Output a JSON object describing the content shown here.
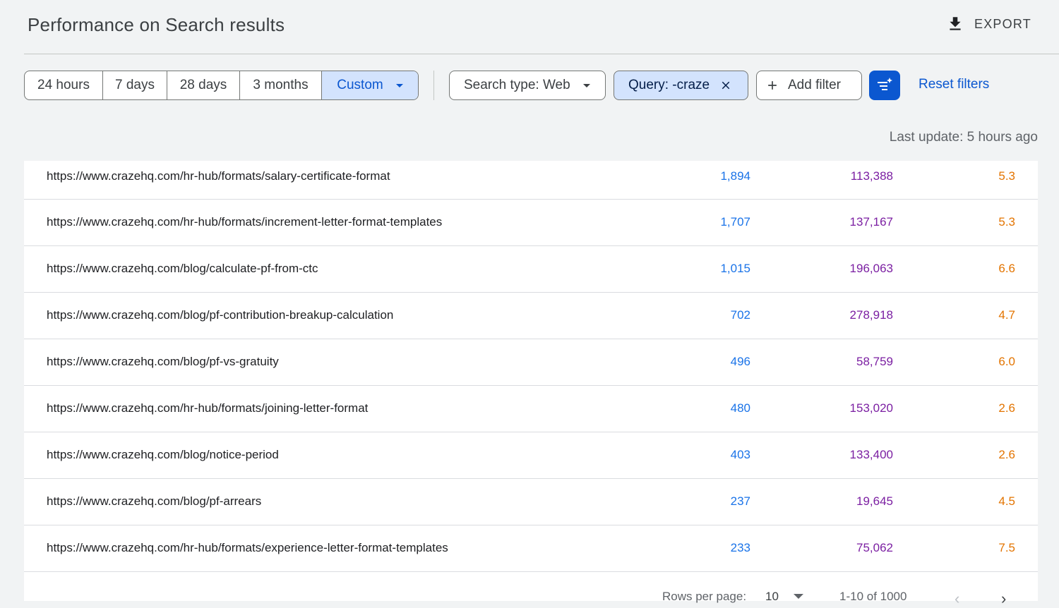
{
  "header": {
    "title": "Performance on Search results",
    "export_label": "EXPORT"
  },
  "filters": {
    "date_ranges": [
      "24 hours",
      "7 days",
      "28 days",
      "3 months",
      "Custom"
    ],
    "search_type": "Search type: Web",
    "query_chip": "Query: -craze",
    "add_filter": "Add filter",
    "reset": "Reset filters"
  },
  "last_update": "Last update: 5 hours ago",
  "rows": [
    {
      "url": "https://www.crazehq.com/hr-hub/formats/salary-certificate-format",
      "clicks": "1,894",
      "impressions": "113,388",
      "position": "5.3"
    },
    {
      "url": "https://www.crazehq.com/hr-hub/formats/increment-letter-format-templates",
      "clicks": "1,707",
      "impressions": "137,167",
      "position": "5.3"
    },
    {
      "url": "https://www.crazehq.com/blog/calculate-pf-from-ctc",
      "clicks": "1,015",
      "impressions": "196,063",
      "position": "6.6"
    },
    {
      "url": "https://www.crazehq.com/blog/pf-contribution-breakup-calculation",
      "clicks": "702",
      "impressions": "278,918",
      "position": "4.7"
    },
    {
      "url": "https://www.crazehq.com/blog/pf-vs-gratuity",
      "clicks": "496",
      "impressions": "58,759",
      "position": "6.0"
    },
    {
      "url": "https://www.crazehq.com/hr-hub/formats/joining-letter-format",
      "clicks": "480",
      "impressions": "153,020",
      "position": "2.6"
    },
    {
      "url": "https://www.crazehq.com/blog/notice-period",
      "clicks": "403",
      "impressions": "133,400",
      "position": "2.6"
    },
    {
      "url": "https://www.crazehq.com/blog/pf-arrears",
      "clicks": "237",
      "impressions": "19,645",
      "position": "4.5"
    },
    {
      "url": "https://www.crazehq.com/hr-hub/formats/experience-letter-format-templates",
      "clicks": "233",
      "impressions": "75,062",
      "position": "7.5"
    }
  ],
  "pager": {
    "rows_per_page_label": "Rows per page:",
    "rows_per_page_value": "10",
    "range": "1-10 of 1000",
    "prev": "‹",
    "next": "›"
  },
  "colors": {
    "accent": "#0b57d0",
    "clicks": "#1a73e8",
    "impressions": "#7b1fa2",
    "position": "#e37400"
  }
}
